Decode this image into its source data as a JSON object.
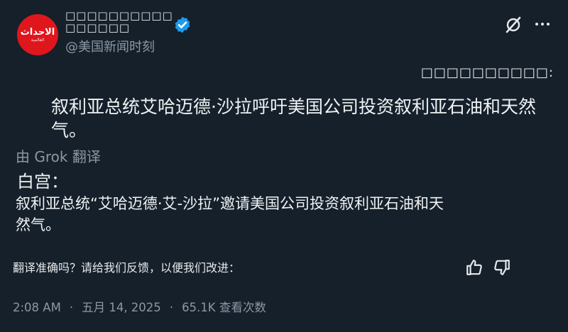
{
  "account": {
    "display_name": "\u0000\u0000\u0000\u0000\u0000\u0000\u0000\u0000\u0000\u0000\u0000\u0000\u0000\u0000\u0000\u0000",
    "display_name_text": "□□□□□□□□□□□□□□□□",
    "handle": "@美国新闻时刻",
    "avatar_text": "الاحداث",
    "avatar_subtext": "العالمية"
  },
  "icons": {
    "verified": "verified-badge-icon",
    "grok": "grok-icon",
    "more": "more-icon",
    "thumbs_up": "thumbs-up-icon",
    "thumbs_down": "thumbs-down-icon"
  },
  "post": {
    "garbled_label": "□□□□□□□□□□:",
    "original_text": "叙利亚总统艾哈迈德·沙拉呼吁美国公司投资叙利亚石油和天然气。",
    "translated_by": "由 Grok 翻译",
    "translation_heading": "白宫：",
    "translation_body": "叙利亚总统“艾哈迈德·艾-沙拉”邀请美国公司投资叙利亚石油和天然气。"
  },
  "feedback": {
    "prompt": "翻译准确吗？请给我们反馈，以便我们改进："
  },
  "meta": {
    "time": "2:08 AM",
    "separator": "·",
    "date": "五月 14, 2025",
    "views": "65.1K 查看次数"
  },
  "colors": {
    "background": "#15202b",
    "text": "#e7e9ea",
    "muted": "#8b98a5",
    "verified": "#1d9bf0",
    "avatar": "#e0161d"
  }
}
